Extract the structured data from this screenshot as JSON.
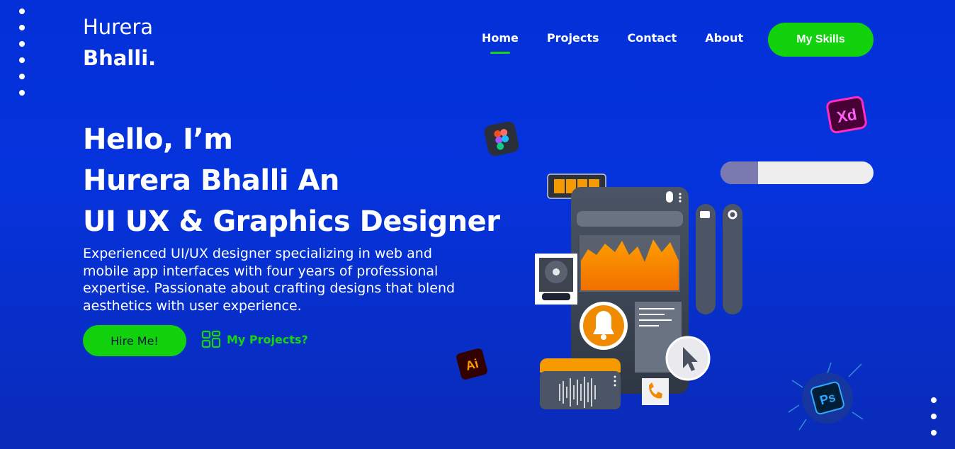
{
  "brand": {
    "line1": "Hurera",
    "line2": "Bhalli."
  },
  "nav": {
    "items": [
      {
        "label": "Home",
        "active": true
      },
      {
        "label": "Projects",
        "active": false
      },
      {
        "label": "Contact",
        "active": false
      },
      {
        "label": "About",
        "active": false
      }
    ],
    "cta_label": "My Skills"
  },
  "hero": {
    "line1": "Hello, I’m",
    "line2": "Hurera Bhalli An",
    "line3": "UI UX & Graphics Designer",
    "description": "Experienced UI/UX designer specializing in web and mobile app interfaces with four years of professional expertise. Passionate about crafting designs that blend aesthetics with user experience.",
    "hire_label": "Hire Me!",
    "projects_label": "My Projects?"
  },
  "illustration": {
    "badges": {
      "xd": "Xd",
      "ai": "Ai",
      "ps": "Ps"
    },
    "icons": [
      "figma-icon",
      "xd-icon",
      "ai-icon",
      "ps-icon",
      "bell-icon",
      "cursor-icon",
      "phone-icon",
      "video-icon",
      "gear-icon",
      "disk-icon"
    ]
  },
  "colors": {
    "background": "#0533dc",
    "accent": "#12d10d",
    "orange": "#f59a00"
  }
}
